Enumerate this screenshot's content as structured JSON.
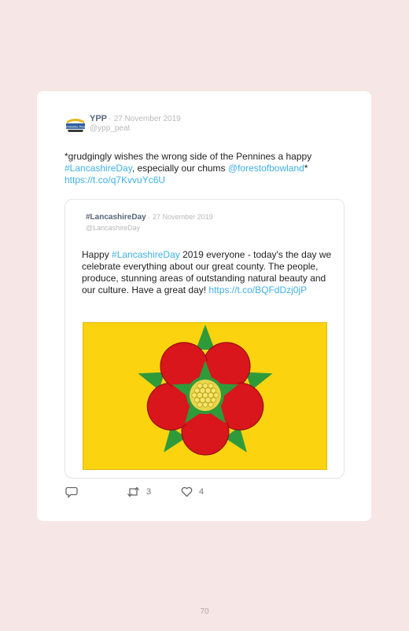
{
  "tweet": {
    "author_name": "YPP",
    "separator": "·",
    "date": "27 November 2019",
    "handle": "@ypp_peat",
    "text_parts": {
      "t1": "*grudgingly wishes the wrong side of the Pennines a happy ",
      "hashtag": "#LancashireDay",
      "t2": ", especially our chums ",
      "mention": "@forestofbowland",
      "t3": "*",
      "url": "https://t.co/q7KvvuYc6U"
    },
    "avatar_text": "Yorkshire Peat"
  },
  "quoted_tweet": {
    "author_name": "#LancashireDay",
    "separator": "·",
    "date": "27 November 2019",
    "handle": "@LancashireDay",
    "text_parts": {
      "t1": "Happy ",
      "hashtag": "#LancashireDay",
      "t2": " 2019 everyone - today's the day we celebrate everything about our great county. The people, produce, stunning areas of outstanding natural beauty and our culture. Have a great day! ",
      "url": "https://t.co/BQFdDzj0jP"
    }
  },
  "actions": {
    "reply_icon": "speech-bubble-icon",
    "retweet_icon": "retweet-icon",
    "retweet_count": "3",
    "like_icon": "heart-icon",
    "like_count": "4"
  },
  "colors": {
    "background": "#f7e6e6",
    "link": "#3fb0e8",
    "flag_yellow": "#fbd40f",
    "rose_red": "#d8161b",
    "leaf_green": "#2f9a3a"
  },
  "page_number": "70"
}
